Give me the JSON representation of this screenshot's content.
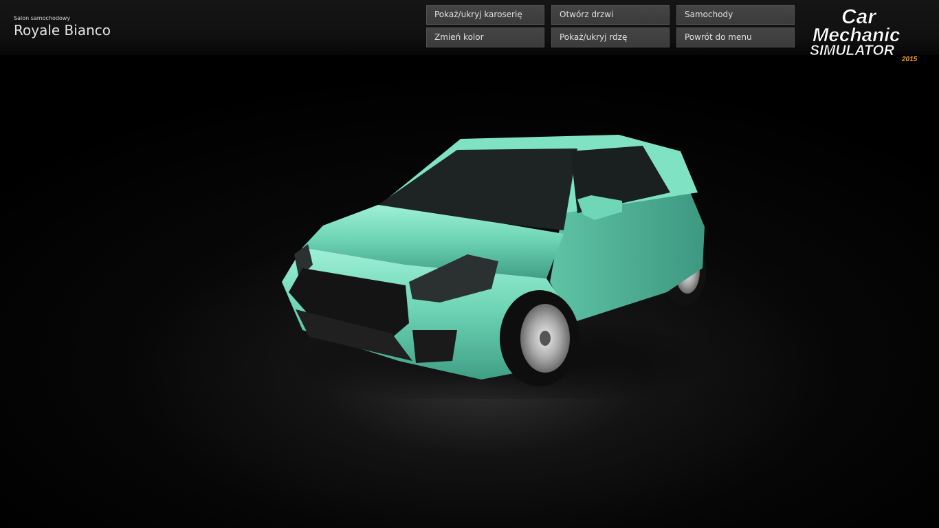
{
  "header": {
    "location_subtitle": "Salon samochodowy",
    "location_title": "Royale Bianco"
  },
  "buttons": {
    "toggle_body": "Pokaż/ukryj karoserię",
    "open_doors": "Otwórz drzwi",
    "cars": "Samochody",
    "change_color": "Zmień kolor",
    "toggle_rust": "Pokaż/ukryj rdzę",
    "back_to_menu": "Powrót do menu"
  },
  "logo": {
    "line1": "Car",
    "line2": "Mechanic",
    "line3": "SIMULATOR",
    "year": "2015"
  },
  "colors": {
    "car_body": "#6fd6b6",
    "logo_year": "#f0a020"
  }
}
